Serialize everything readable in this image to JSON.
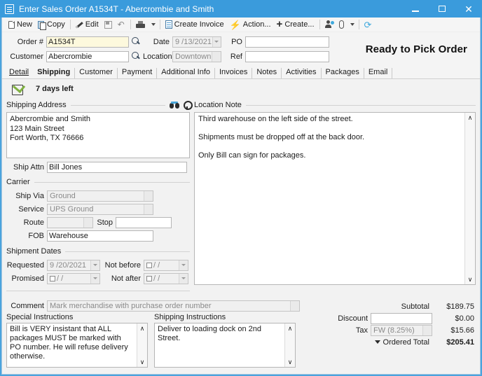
{
  "window": {
    "title": "Enter Sales Order A1534T - Abercrombie and Smith",
    "doc_icon": "document-icon",
    "minimize": "–",
    "maximize": "□",
    "close": "✕"
  },
  "toolbar": {
    "items": [
      {
        "label": "New",
        "icon": "new-page-icon"
      },
      {
        "label": "Copy",
        "icon": "copy-icon"
      },
      {
        "label": "Edit",
        "icon": "pencil-icon"
      },
      {
        "label": "",
        "icon": "save-icon"
      },
      {
        "label": "",
        "icon": "undo-icon"
      },
      {
        "label": "",
        "icon": "print-icon"
      },
      {
        "label": "Create Invoice",
        "icon": "create-invoice-icon"
      },
      {
        "label": "Action...",
        "icon": "lightning-bolt-icon"
      },
      {
        "label": "Create...",
        "icon": "plus-icon"
      },
      {
        "label": "",
        "icon": "add-contact-icon"
      },
      {
        "label": "",
        "icon": "attachment-icon"
      },
      {
        "label": "",
        "icon": "refresh-icon"
      }
    ],
    "undo_glyph": "↶",
    "refresh_glyph": "⟳"
  },
  "header": {
    "order_label": "Order #",
    "order_value": "A1534T",
    "customer_label": "Customer",
    "customer_value": "Abercrombie",
    "date_label": "Date",
    "date_value": "9 /13/2021",
    "location_label": "Location",
    "location_value": "Downtown",
    "po_label": "PO",
    "po_value": "",
    "ref_label": "Ref",
    "ref_value": "",
    "status_banner": "Ready to Pick Order"
  },
  "tabs": [
    {
      "label": "Detail",
      "state": "underlined"
    },
    {
      "label": "Shipping",
      "state": "active"
    },
    {
      "label": "Customer",
      "state": "normal"
    },
    {
      "label": "Payment",
      "state": "normal"
    },
    {
      "label": "Additional Info",
      "state": "normal"
    },
    {
      "label": "Invoices",
      "state": "normal"
    },
    {
      "label": "Notes",
      "state": "normal"
    },
    {
      "label": "Activities",
      "state": "normal"
    },
    {
      "label": "Packages",
      "state": "normal"
    },
    {
      "label": "Email",
      "state": "normal"
    }
  ],
  "status_row": {
    "icon": "clipboard-check-icon",
    "text": "7 days left"
  },
  "shipping_address": {
    "section_title": "Shipping Address",
    "icons": [
      "binoculars-icon",
      "map-pin-icon"
    ],
    "lines": [
      "Abercrombie and Smith",
      "123 Main Street",
      "Fort Worth, TX 76666"
    ],
    "ship_attn_label": "Ship Attn",
    "ship_attn_value": "Bill Jones"
  },
  "carrier": {
    "section_title": "Carrier",
    "ship_via_label": "Ship Via",
    "ship_via_value": "Ground",
    "service_label": "Service",
    "service_value": "UPS Ground",
    "route_label": "Route",
    "route_value": "",
    "stop_label": "Stop",
    "stop_value": "",
    "fob_label": "FOB",
    "fob_value": "Warehouse"
  },
  "shipment_dates": {
    "section_title": "Shipment Dates",
    "requested_label": "Requested",
    "requested_value": "9 /20/2021",
    "not_before_label": "Not before",
    "not_before_value": "  /  /",
    "promised_label": "Promised",
    "promised_value": "  /  /",
    "not_after_label": "Not after",
    "not_after_value": "  /  /"
  },
  "location_note": {
    "section_title": "Location Note",
    "paragraphs": [
      "Third warehouse on the left side of the street.",
      "Shipments must be dropped off at the back door.",
      "Only Bill can sign for packages."
    ],
    "scroll_up": "∧",
    "scroll_down": "∨"
  },
  "comment": {
    "label": "Comment",
    "value": "Mark merchandise with purchase order number"
  },
  "special_instructions": {
    "label": "Special Instructions",
    "text": "Bill is VERY insistant that ALL packages MUST be marked with PO number.  He will refuse delivery otherwise.",
    "scroll_up": "∧",
    "scroll_down": "∨"
  },
  "shipping_instructions": {
    "label": "Shipping Instructions",
    "text": "Deliver to loading dock on 2nd Street.",
    "scroll_up": "∧",
    "scroll_down": "∨"
  },
  "totals": {
    "subtotal_label": "Subtotal",
    "subtotal_value": "$189.75",
    "discount_label": "Discount",
    "discount_input": "",
    "discount_value": "$0.00",
    "tax_label": "Tax",
    "tax_value": "FW (8.25%)",
    "tax_amount": "$15.66",
    "ordered_total_label": "Ordered Total",
    "ordered_total_value": "$205.41"
  },
  "colors": {
    "titlebar": "#3a9bdc",
    "window_border": "#4aa3dd",
    "accent_blue": "#3fa9dd",
    "check_green": "#7fb040",
    "field_yellow": "#fdf9dd"
  }
}
